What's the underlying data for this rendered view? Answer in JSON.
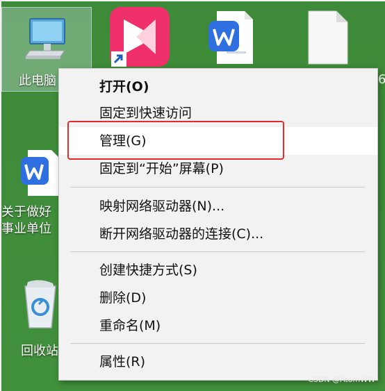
{
  "desktop": {
    "icons": [
      {
        "label": "此电脑",
        "icon": "this-pc-icon"
      },
      {
        "label": "",
        "icon": "app-shortcut-icon"
      },
      {
        "label": "",
        "icon": "wps-doc-icon"
      },
      {
        "label": "",
        "icon": "blank-file-icon"
      },
      {
        "label": "关于做好\n事业单位",
        "icon": "wps-doc-icon"
      },
      {
        "label": "回收站",
        "icon": "recycle-bin-icon"
      }
    ],
    "visible_text": {
      "pc_label": "此电脑",
      "doc_label_line1": "关于做好",
      "doc_label_line2": "事业单位",
      "recycle_label": "回收站",
      "right_edge_char": "6"
    }
  },
  "context_menu": {
    "items": [
      {
        "label": "打开(O)",
        "bold": true
      },
      {
        "label": "固定到快速访问"
      },
      {
        "label": "管理(G)",
        "highlighted": true
      },
      {
        "label": "固定到“开始”屏幕(P)"
      },
      {
        "label": "映射网络驱动器(N)..."
      },
      {
        "label": "断开网络驱动器的连接(C)..."
      },
      {
        "label": "创建快捷方式(S)"
      },
      {
        "label": "删除(D)"
      },
      {
        "label": "重命名(M)"
      },
      {
        "label": "属性(R)"
      }
    ]
  },
  "watermark": "CSDN @AtomWW",
  "colors": {
    "desktop_bg": "#3f8c3a",
    "menu_bg": "#f2f2f2",
    "highlight_border": "#e52b2b",
    "wps_blue": "#2f6fe0",
    "app_pink": "#f0306a"
  }
}
